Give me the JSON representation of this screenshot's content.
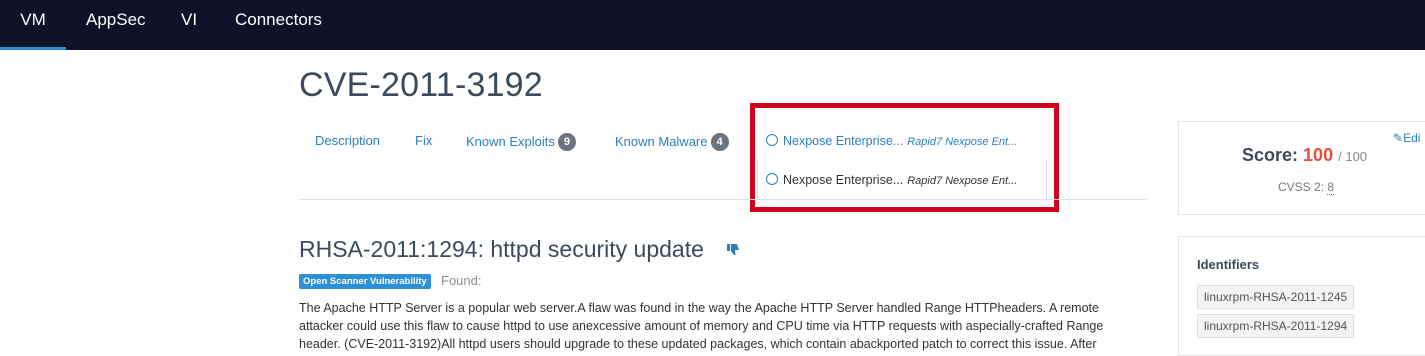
{
  "topnav": {
    "tabs": [
      "VM",
      "AppSec",
      "VI",
      "Connectors"
    ]
  },
  "title": "CVE-2011-3192",
  "subtabs": {
    "description": "Description",
    "fix": "Fix",
    "known_exploits": "Known Exploits",
    "known_exploits_count": "9",
    "known_malware": "Known Malware",
    "known_malware_count": "4"
  },
  "sources": [
    {
      "name": "Nexpose Enterprise...",
      "detail": "Rapid7 Nexpose Ent..."
    },
    {
      "name": "Nexpose Enterprise...",
      "detail": "Rapid7 Nexpose Ent..."
    }
  ],
  "vuln": {
    "title": "RHSA-2011:1294: httpd security update",
    "tag": "Open Scanner Vulnerability",
    "found_label": "Found:",
    "description_lines": [
      "The Apache HTTP Server is a popular web server.A flaw was found in the way the Apache HTTP Server handled Range HTTPheaders. A remote",
      "attacker could use this flaw to cause httpd to use anexcessive amount of memory and CPU time via HTTP requests with aspecially-crafted Range",
      "header. (CVE-2011-3192)All httpd users should upgrade to these updated packages, which contain abackported patch to correct this issue. After"
    ]
  },
  "score_panel": {
    "edit_label": "Edi",
    "score_label": "Score:",
    "score_value": "100",
    "score_max": "/ 100",
    "cvss_label": "CVSS 2:",
    "cvss_value": "8"
  },
  "identifiers": {
    "heading": "Identifiers",
    "items": [
      "linuxrpm-RHSA-2011-1245",
      "linuxrpm-RHSA-2011-1294"
    ]
  },
  "colors": {
    "nav_bg": "#0f1127",
    "accent": "#2a7fc1",
    "highlight": "#d0021b",
    "score": "#e74c3c"
  }
}
